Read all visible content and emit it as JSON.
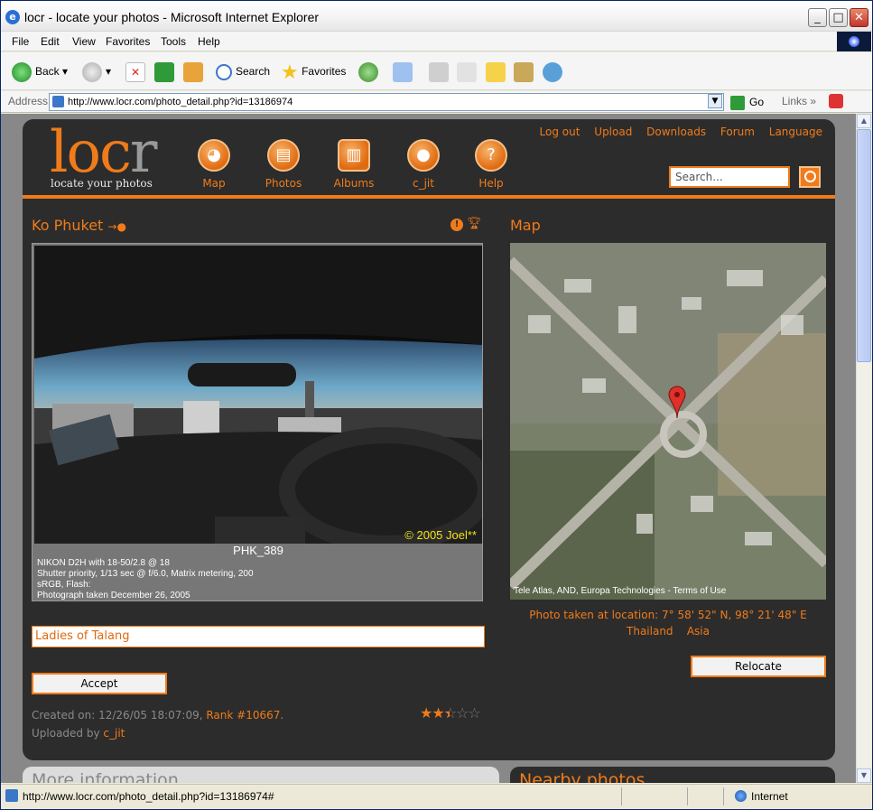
{
  "window": {
    "title": "locr - locate your photos - Microsoft Internet Explorer"
  },
  "menu": [
    "File",
    "Edit",
    "View",
    "Favorites",
    "Tools",
    "Help"
  ],
  "toolbar": {
    "back": "Back",
    "search": "Search",
    "favorites": "Favorites"
  },
  "address": {
    "label": "Address",
    "url": "http://www.locr.com/photo_detail.php?id=13186974",
    "go": "Go",
    "links": "Links"
  },
  "status": {
    "url": "http://www.locr.com/photo_detail.php?id=13186974#",
    "zone": "Internet"
  },
  "site": {
    "brand": "locr",
    "tagline": "locate your photos",
    "nav": [
      {
        "label": "Map",
        "icon": "globe-icon"
      },
      {
        "label": "Photos",
        "icon": "photos-icon"
      },
      {
        "label": "Albums",
        "icon": "album-icon"
      },
      {
        "label": "c_jit",
        "icon": "user-icon"
      },
      {
        "label": "Help",
        "icon": "help-icon"
      }
    ],
    "toplinks": [
      "Log out",
      "Upload",
      "Downloads",
      "Forum",
      "Language"
    ],
    "search_placeholder": "Search..."
  },
  "photo": {
    "title": "Ko Phuket",
    "filename": "PHK_389",
    "copyright": "© 2005 Joel**",
    "exif": [
      "NIKON D2H with 18-50/2.8 @ 18",
      "Shutter priority, 1/13 sec @ f/6.0, Matrix metering, 200",
      "sRGB, Flash:",
      "Photograph taken December 26, 2005"
    ],
    "caption": "Ladies of Talang",
    "accept": "Accept",
    "created_label": "Created on: 12/26/05 18:07:09, ",
    "rank": "Rank #10667",
    "rank_suffix": ".",
    "uploaded_label": "Uploaded by ",
    "uploader": "c_jit",
    "rating": 2.5
  },
  "map": {
    "title": "Map",
    "attribution": "Tele Atlas, AND, Europa Technologies - Terms of Use",
    "location_label": "Photo taken at location: 7° 58' 52\" N, 98° 21' 48\" E",
    "country": "Thailand",
    "continent": "Asia",
    "relocate": "Relocate"
  },
  "lower": {
    "more": "More information",
    "nearby": "Nearby photos"
  }
}
